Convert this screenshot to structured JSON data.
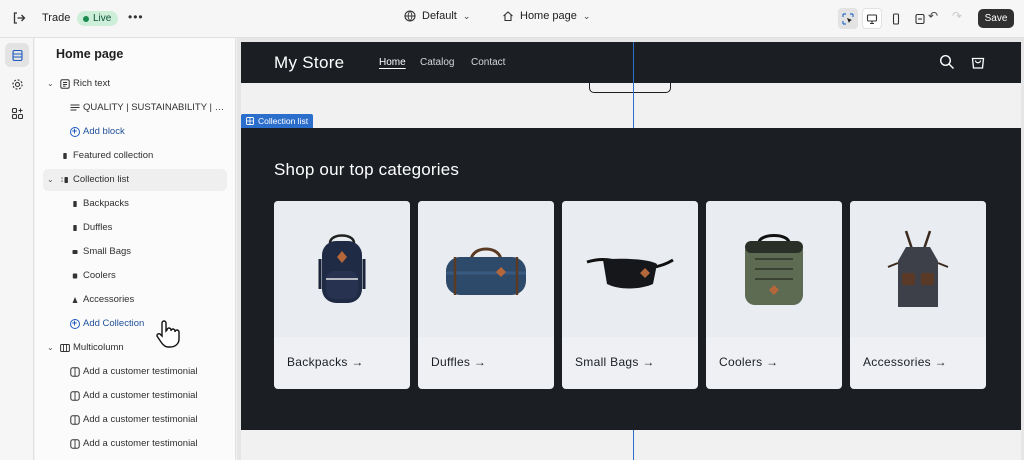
{
  "topbar": {
    "theme_name": "Trade",
    "status_badge": "Live",
    "more_label": "•••",
    "template_select": "Default",
    "page_select": "Home page",
    "save_label": "Save"
  },
  "sidebar": {
    "title": "Home page",
    "rows": [
      {
        "label": "Rich text",
        "kind": "section",
        "icon": "text-block-icon"
      },
      {
        "label": "QUALITY | SUSTAINABILITY | IN...",
        "kind": "block",
        "icon": "text-lines-icon"
      },
      {
        "label": "Add block",
        "kind": "add"
      },
      {
        "label": "Featured collection",
        "kind": "section",
        "icon": "grip-icon"
      },
      {
        "label": "Collection list",
        "kind": "section",
        "icon": "grip-icon"
      },
      {
        "label": "Backpacks",
        "kind": "block",
        "icon": "grip-icon"
      },
      {
        "label": "Duffles",
        "kind": "block",
        "icon": "grip-icon"
      },
      {
        "label": "Small Bags",
        "kind": "block",
        "icon": "grip-icon"
      },
      {
        "label": "Coolers",
        "kind": "block",
        "icon": "grip-icon"
      },
      {
        "label": "Accessories",
        "kind": "block",
        "icon": "grip-icon"
      },
      {
        "label": "Add Collection",
        "kind": "add"
      },
      {
        "label": "Multicolumn",
        "kind": "section",
        "icon": "columns-icon"
      },
      {
        "label": "Add a customer testimonial",
        "kind": "block",
        "icon": "column-icon"
      },
      {
        "label": "Add a customer testimonial",
        "kind": "block",
        "icon": "column-icon"
      },
      {
        "label": "Add a customer testimonial",
        "kind": "block",
        "icon": "column-icon"
      },
      {
        "label": "Add a customer testimonial",
        "kind": "block",
        "icon": "column-icon"
      }
    ]
  },
  "store": {
    "logo": "My Store",
    "nav": [
      "Home",
      "Catalog",
      "Contact"
    ],
    "section_tag": "Collection list",
    "collection_title": "Shop our top categories",
    "cards": [
      {
        "name": "Backpacks →",
        "icon": "backpack-image"
      },
      {
        "name": "Duffles →",
        "icon": "duffle-bag-image"
      },
      {
        "name": "Small Bags →",
        "icon": "sling-bag-image"
      },
      {
        "name": "Coolers →",
        "icon": "cooler-bag-image"
      },
      {
        "name": "Accessories →",
        "icon": "apron-image"
      }
    ]
  },
  "colors": {
    "dark_bg": "#1b1f24",
    "accent_blue": "#2c6ecb",
    "live_green": "#1b8a4e",
    "card_bg": "#eef0f3"
  }
}
